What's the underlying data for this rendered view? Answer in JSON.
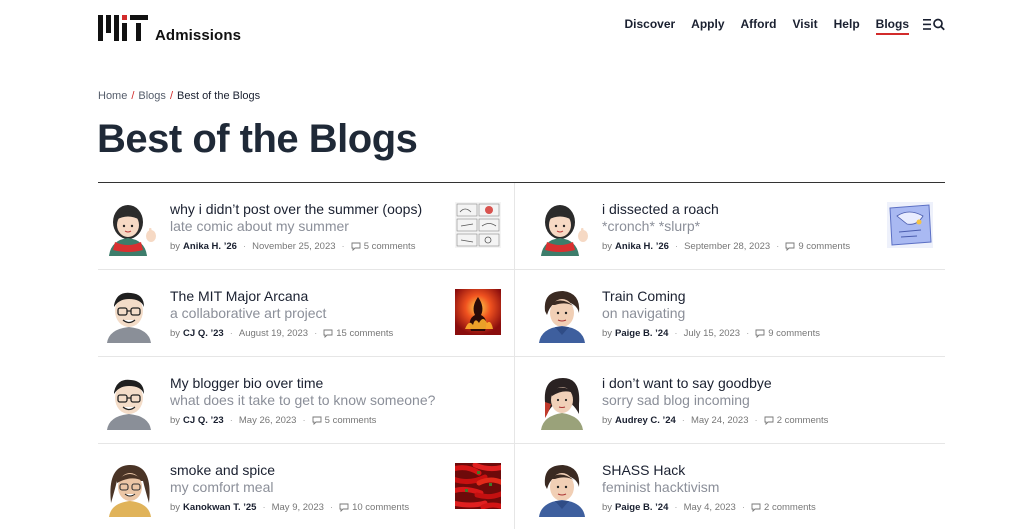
{
  "header": {
    "logo_text": "Admissions",
    "nav": [
      "Discover",
      "Apply",
      "Afford",
      "Visit",
      "Help",
      "Blogs"
    ],
    "active_nav": "Blogs"
  },
  "breadcrumb": {
    "items": [
      "Home",
      "Blogs",
      "Best of the Blogs"
    ],
    "separator": "/"
  },
  "page": {
    "title": "Best of the Blogs"
  },
  "colors": {
    "accent": "#d22b2b",
    "title": "#1f2937",
    "subtitle": "#8b8f99"
  },
  "posts": [
    {
      "title": "why i didn’t post over the summer (oops)",
      "subtitle": "late comic about my summer",
      "by": "by",
      "author": "Anika H. ’26",
      "date": "November 25, 2023",
      "comments": "5 comments",
      "avatar": "anika",
      "thumb": "sketch-comic"
    },
    {
      "title": "i dissected a roach",
      "subtitle": "*cronch* *slurp*",
      "by": "by",
      "author": "Anika H. ’26",
      "date": "September 28, 2023",
      "comments": "9 comments",
      "avatar": "anika",
      "thumb": "blue-drawing"
    },
    {
      "title": "The MIT Major Arcana",
      "subtitle": "a collaborative art project",
      "by": "by",
      "author": "CJ Q. ’23",
      "date": "August 19, 2023",
      "comments": "15 comments",
      "avatar": "cj",
      "thumb": "fire-card"
    },
    {
      "title": "Train Coming",
      "subtitle": "on navigating",
      "by": "by",
      "author": "Paige B. ’24",
      "date": "July 15, 2023",
      "comments": "9 comments",
      "avatar": "paige",
      "thumb": ""
    },
    {
      "title": "My blogger bio over time",
      "subtitle": "what does it take to get to know someone?",
      "by": "by",
      "author": "CJ Q. ’23",
      "date": "May 26, 2023",
      "comments": "5 comments",
      "avatar": "cj",
      "thumb": ""
    },
    {
      "title": "i don’t want to say goodbye",
      "subtitle": "sorry sad blog incoming",
      "by": "by",
      "author": "Audrey C. ’24",
      "date": "May 24, 2023",
      "comments": "2 comments",
      "avatar": "audrey",
      "thumb": ""
    },
    {
      "title": "smoke and spice",
      "subtitle": "my comfort meal",
      "by": "by",
      "author": "Kanokwan T. ’25",
      "date": "May 9, 2023",
      "comments": "10 comments",
      "avatar": "kanokwan",
      "thumb": "chili-peppers"
    },
    {
      "title": "SHASS Hack",
      "subtitle": "feminist hacktivism",
      "by": "by",
      "author": "Paige B. ’24",
      "date": "May 4, 2023",
      "comments": "2 comments",
      "avatar": "paige",
      "thumb": ""
    }
  ]
}
